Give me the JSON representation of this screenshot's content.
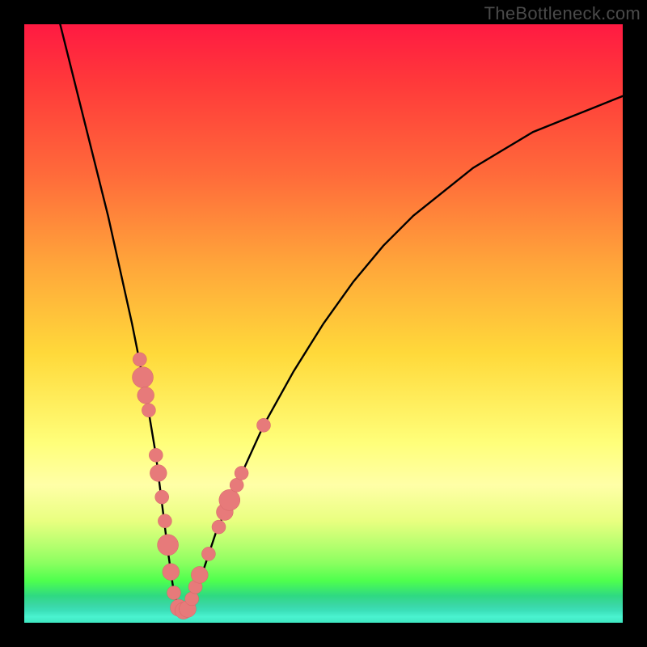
{
  "watermark": "TheBottleneck.com",
  "chart_data": {
    "type": "line",
    "title": "",
    "xlabel": "",
    "ylabel": "",
    "xlim": [
      0,
      100
    ],
    "ylim": [
      0,
      100
    ],
    "curve": {
      "name": "bottleneck-curve",
      "x": [
        6,
        8,
        10,
        12,
        14,
        16,
        18,
        20,
        22,
        23,
        24,
        25,
        26,
        27,
        28,
        30,
        32,
        35,
        40,
        45,
        50,
        55,
        60,
        65,
        70,
        75,
        80,
        85,
        90,
        95,
        100
      ],
      "y": [
        100,
        92,
        84,
        76,
        68,
        59,
        50,
        40,
        28,
        20,
        12,
        5,
        2,
        2,
        4,
        9,
        15,
        22,
        33,
        42,
        50,
        57,
        63,
        68,
        72,
        76,
        79,
        82,
        84,
        86,
        88
      ]
    },
    "scatter": {
      "name": "highlighted-data-points",
      "points": [
        {
          "x": 19.3,
          "y": 44.0,
          "r": 1.3
        },
        {
          "x": 19.8,
          "y": 41.0,
          "r": 2.0
        },
        {
          "x": 20.3,
          "y": 38.0,
          "r": 1.6
        },
        {
          "x": 20.8,
          "y": 35.5,
          "r": 1.3
        },
        {
          "x": 22.0,
          "y": 28.0,
          "r": 1.3
        },
        {
          "x": 22.4,
          "y": 25.0,
          "r": 1.6
        },
        {
          "x": 23.0,
          "y": 21.0,
          "r": 1.3
        },
        {
          "x": 23.5,
          "y": 17.0,
          "r": 1.3
        },
        {
          "x": 24.0,
          "y": 13.0,
          "r": 2.0
        },
        {
          "x": 24.5,
          "y": 8.5,
          "r": 1.6
        },
        {
          "x": 25.0,
          "y": 5.0,
          "r": 1.3
        },
        {
          "x": 25.8,
          "y": 2.5,
          "r": 1.6
        },
        {
          "x": 26.6,
          "y": 2.0,
          "r": 1.6
        },
        {
          "x": 27.3,
          "y": 2.3,
          "r": 1.6
        },
        {
          "x": 28.0,
          "y": 4.0,
          "r": 1.3
        },
        {
          "x": 28.6,
          "y": 6.0,
          "r": 1.3
        },
        {
          "x": 29.3,
          "y": 8.0,
          "r": 1.6
        },
        {
          "x": 30.8,
          "y": 11.5,
          "r": 1.3
        },
        {
          "x": 32.5,
          "y": 16.0,
          "r": 1.3
        },
        {
          "x": 33.5,
          "y": 18.5,
          "r": 1.6
        },
        {
          "x": 34.3,
          "y": 20.5,
          "r": 2.0
        },
        {
          "x": 35.5,
          "y": 23.0,
          "r": 1.3
        },
        {
          "x": 36.3,
          "y": 25.0,
          "r": 1.3
        },
        {
          "x": 40.0,
          "y": 33.0,
          "r": 1.3
        }
      ]
    },
    "gradient_bands": [
      {
        "color": "#ff1a42",
        "stop": 0
      },
      {
        "color": "#ffa53a",
        "stop": 40
      },
      {
        "color": "#ffff7a",
        "stop": 70
      },
      {
        "color": "#4eff4e",
        "stop": 93
      },
      {
        "color": "#3fe7c1",
        "stop": 100
      }
    ]
  }
}
